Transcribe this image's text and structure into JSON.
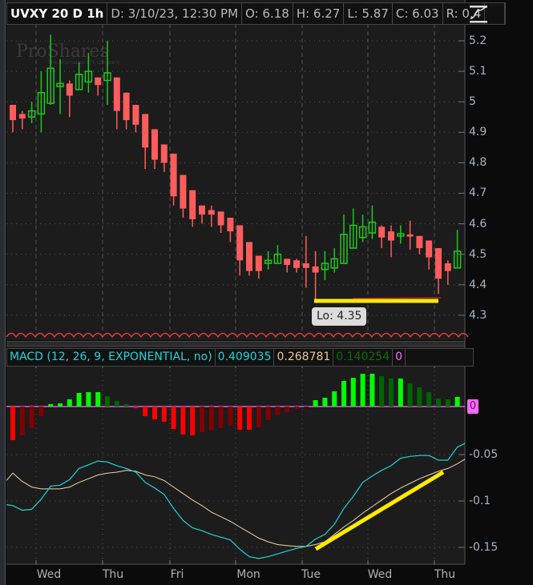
{
  "header": {
    "symbol": "UVXY 20 D 1h",
    "date": "D: 3/10/23, 12:30 PM",
    "open": "O: 6.18",
    "high": "H: 6.27",
    "low": "L: 5.87",
    "close": "C: 6.03",
    "range": "R: 0.4"
  },
  "watermark": {
    "brand": "ProShares",
    "tagline": "The Alternative ETF Company"
  },
  "annotation": {
    "low_label": "Lo: 4.35"
  },
  "macd_header": {
    "title": "MACD (12, 26, 9, EXPONENTIAL, no)",
    "value": "0.409035",
    "avg": "0.268781",
    "diff": "0.140254",
    "zero": "0"
  },
  "zero_marker": "0",
  "price_axis": [
    "5.2",
    "5.1",
    "5",
    "4.9",
    "4.8",
    "4.7",
    "4.6",
    "4.5",
    "4.4",
    "4.3"
  ],
  "macd_axis": [
    "-0.05",
    "-0.1",
    "-0.15"
  ],
  "time_axis": [
    "Wed",
    "Thu",
    "Fri",
    "Mon",
    "Tue",
    "Wed",
    "Thu"
  ],
  "colors": {
    "up": "#1ec81e",
    "down": "#ff5c5c",
    "macd": "#22d3d8",
    "signal": "#e8d8a8",
    "hist_up_strong": "#00ff00",
    "hist_up_weak": "#006400",
    "hist_down_strong": "#ff0000",
    "hist_down_weak": "#800000",
    "zero": "#ff66ff",
    "highlight": "#ffea00"
  },
  "chart_data": [
    {
      "type": "candlestick",
      "title": "UVXY 20 D 1h",
      "ylim": [
        4.25,
        5.22
      ],
      "yticks": [
        5.2,
        5.1,
        5.0,
        4.9,
        4.8,
        4.7,
        4.6,
        4.5,
        4.4,
        4.3
      ],
      "x_day_labels": [
        "Wed",
        "Thu",
        "Fri",
        "Mon",
        "Tue",
        "Wed",
        "Thu"
      ],
      "ohlc": [
        [
          4.99,
          4.99,
          4.9,
          4.94
        ],
        [
          4.96,
          4.97,
          4.91,
          4.945
        ],
        [
          4.95,
          5.0,
          4.93,
          4.97
        ],
        [
          4.96,
          5.1,
          4.9,
          5.03
        ],
        [
          4.995,
          5.22,
          4.99,
          5.11
        ],
        [
          5.05,
          5.14,
          4.96,
          5.06
        ],
        [
          5.06,
          5.07,
          4.95,
          5.02
        ],
        [
          5.04,
          5.13,
          5.04,
          5.09
        ],
        [
          5.065,
          5.16,
          5.03,
          5.1
        ],
        [
          5.08,
          5.08,
          5.02,
          5.055
        ],
        [
          5.07,
          5.2,
          4.99,
          5.095
        ],
        [
          5.08,
          5.08,
          4.91,
          4.97
        ],
        [
          5.03,
          5.03,
          4.91,
          4.94
        ],
        [
          4.99,
          4.99,
          4.9,
          4.925
        ],
        [
          4.96,
          4.96,
          4.78,
          4.85
        ],
        [
          4.91,
          4.91,
          4.78,
          4.81
        ],
        [
          4.86,
          4.86,
          4.77,
          4.8
        ],
        [
          4.83,
          4.83,
          4.66,
          4.69
        ],
        [
          4.76,
          4.76,
          4.62,
          4.65
        ],
        [
          4.71,
          4.71,
          4.59,
          4.615
        ],
        [
          4.66,
          4.66,
          4.6,
          4.63
        ],
        [
          4.645,
          4.66,
          4.59,
          4.63
        ],
        [
          4.64,
          4.64,
          4.57,
          4.595
        ],
        [
          4.62,
          4.62,
          4.54,
          4.575
        ],
        [
          4.595,
          4.595,
          4.43,
          4.48
        ],
        [
          4.54,
          4.54,
          4.43,
          4.445
        ],
        [
          4.495,
          4.495,
          4.42,
          4.445
        ],
        [
          4.47,
          4.51,
          4.45,
          4.48
        ],
        [
          4.47,
          4.53,
          4.47,
          4.5
        ],
        [
          4.485,
          4.485,
          4.44,
          4.465
        ],
        [
          4.48,
          4.485,
          4.44,
          4.455
        ],
        [
          4.47,
          4.56,
          4.39,
          4.455
        ],
        [
          4.46,
          4.51,
          4.35,
          4.44
        ],
        [
          4.45,
          4.51,
          4.415,
          4.47
        ],
        [
          4.455,
          4.52,
          4.44,
          4.485
        ],
        [
          4.47,
          4.63,
          4.47,
          4.565
        ],
        [
          4.52,
          4.65,
          4.52,
          4.595
        ],
        [
          4.555,
          4.63,
          4.54,
          4.59
        ],
        [
          4.57,
          4.66,
          4.55,
          4.605
        ],
        [
          4.59,
          4.595,
          4.52,
          4.555
        ],
        [
          4.575,
          4.595,
          4.49,
          4.545
        ],
        [
          4.56,
          4.595,
          4.535,
          4.567
        ],
        [
          4.565,
          4.61,
          4.515,
          4.558
        ],
        [
          4.56,
          4.56,
          4.5,
          4.52
        ],
        [
          4.545,
          4.545,
          4.45,
          4.49
        ],
        [
          4.52,
          4.52,
          4.37,
          4.42
        ],
        [
          4.47,
          4.48,
          4.4,
          4.445
        ],
        [
          4.455,
          4.58,
          4.455,
          4.51
        ]
      ],
      "annotations": [
        {
          "type": "hline",
          "value": 4.35,
          "label": "Lo: 4.35"
        }
      ]
    },
    {
      "type": "line+bar",
      "title": "MACD (12, 26, 9, EXPONENTIAL, no)",
      "ylim": [
        -0.17,
        -0.03
      ],
      "yticks": [
        -0.05,
        -0.1,
        -0.15
      ],
      "series": [
        {
          "name": "Value",
          "values": [
            -0.105,
            -0.11,
            -0.109,
            -0.098,
            -0.084,
            -0.083,
            -0.077,
            -0.065,
            -0.061,
            -0.057,
            -0.058,
            -0.062,
            -0.065,
            -0.069,
            -0.08,
            -0.086,
            -0.093,
            -0.108,
            -0.121,
            -0.129,
            -0.132,
            -0.136,
            -0.139,
            -0.142,
            -0.152,
            -0.16,
            -0.162,
            -0.16,
            -0.157,
            -0.154,
            -0.151,
            -0.149,
            -0.141,
            -0.136,
            -0.125,
            -0.108,
            -0.095,
            -0.08,
            -0.073,
            -0.067,
            -0.062,
            -0.054,
            -0.052,
            -0.051,
            -0.051,
            -0.056,
            -0.056,
            -0.042
          ]
        },
        {
          "name": "Avg",
          "values": [
            -0.07,
            -0.079,
            -0.085,
            -0.087,
            -0.087,
            -0.087,
            -0.085,
            -0.08,
            -0.076,
            -0.072,
            -0.07,
            -0.069,
            -0.067,
            -0.068,
            -0.072,
            -0.074,
            -0.078,
            -0.085,
            -0.092,
            -0.099,
            -0.105,
            -0.112,
            -0.117,
            -0.122,
            -0.128,
            -0.134,
            -0.14,
            -0.144,
            -0.147,
            -0.148,
            -0.149,
            -0.149,
            -0.147,
            -0.144,
            -0.136,
            -0.128,
            -0.121,
            -0.113,
            -0.106,
            -0.099,
            -0.092,
            -0.086,
            -0.081,
            -0.076,
            -0.072,
            -0.068,
            -0.065,
            -0.06
          ]
        },
        {
          "name": "Diff",
          "type": "bar",
          "values": [
            -0.042,
            -0.036,
            -0.027,
            -0.012,
            0.003,
            0.004,
            0.009,
            0.017,
            0.018,
            0.018,
            0.013,
            0.007,
            0.003,
            -0.002,
            -0.012,
            -0.016,
            -0.019,
            -0.028,
            -0.035,
            -0.036,
            -0.032,
            -0.029,
            -0.027,
            -0.024,
            -0.029,
            -0.029,
            -0.026,
            -0.017,
            -0.011,
            -0.007,
            -0.003,
            -0.001,
            0.008,
            0.011,
            0.019,
            0.032,
            0.036,
            0.041,
            0.041,
            0.038,
            0.035,
            0.035,
            0.029,
            0.024,
            0.018,
            0.01,
            0.009,
            0.012
          ]
        }
      ],
      "annotations": [
        {
          "type": "trendline",
          "on": "Avg",
          "direction": "up"
        }
      ]
    }
  ]
}
